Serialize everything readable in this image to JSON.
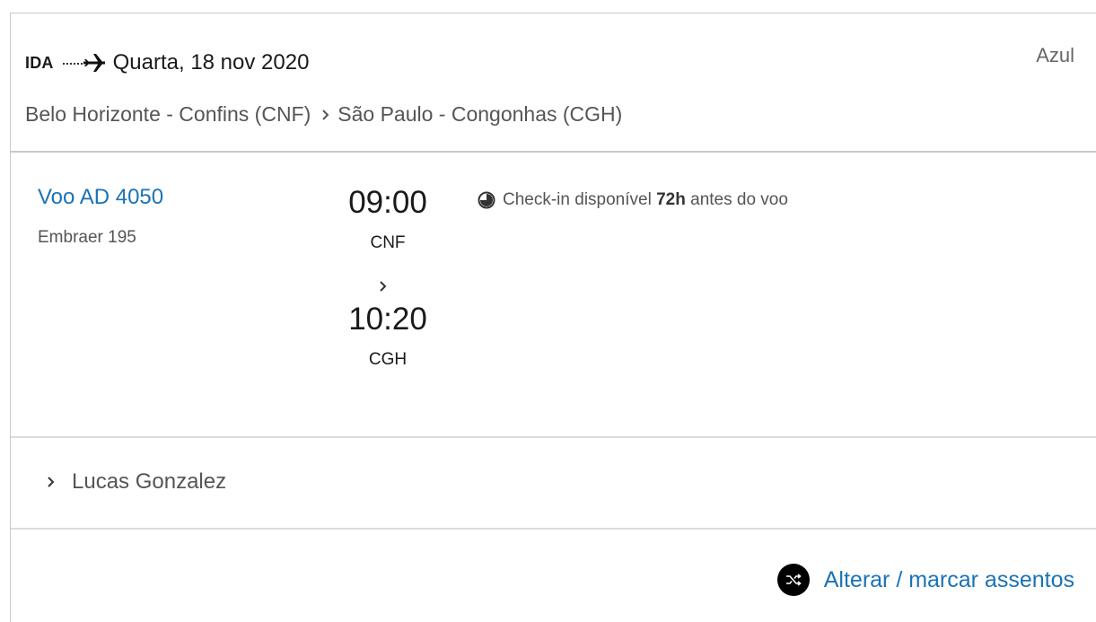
{
  "header": {
    "direction": "IDA",
    "date": "Quarta, 18 nov 2020",
    "airline": "Azul",
    "origin": "Belo Horizonte - Confins (CNF)",
    "destination": "São Paulo - Congonhas (CGH)"
  },
  "flight": {
    "number": "Voo AD 4050",
    "aircraft": "Embraer 195",
    "departure_time": "09:00",
    "departure_code": "CNF",
    "arrival_time": "10:20",
    "arrival_code": "CGH",
    "checkin_prefix": "Check-in disponível",
    "checkin_hours": "72h",
    "checkin_suffix": "antes do voo"
  },
  "passenger": {
    "name": "Lucas Gonzalez"
  },
  "actions": {
    "seats_label": "Alterar / marcar assentos"
  },
  "colors": {
    "link": "#1a73b5",
    "text": "#555555"
  },
  "icons": {
    "plane": "plane-icon",
    "chevron": "chevron-right-icon",
    "clock": "clock-icon",
    "shuffle": "shuffle-icon"
  }
}
